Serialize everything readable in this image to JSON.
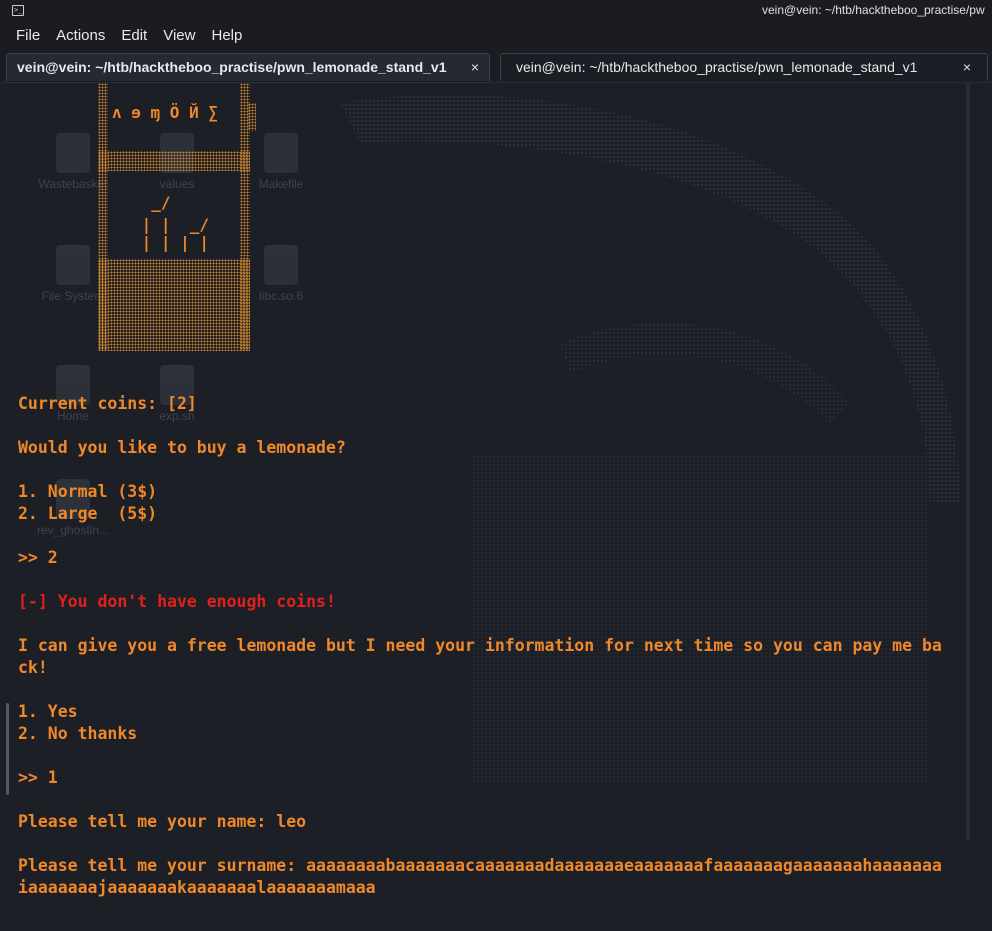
{
  "window": {
    "title": "vein@vein: ~/htb/hacktheboo_practise/pw",
    "menu": [
      "File",
      "Actions",
      "Edit",
      "View",
      "Help"
    ]
  },
  "tabs": [
    {
      "label": "vein@vein: ~/htb/hacktheboo_practise/pwn_lemonade_stand_v1",
      "close": "×",
      "active": true
    },
    {
      "label": "vein@vein: ~/htb/hacktheboo_practise/pwn_lemonade_stand_v1",
      "close": "×",
      "active": false
    }
  ],
  "desktop_icons": [
    {
      "label": "Wastebasket"
    },
    {
      "label": "values"
    },
    {
      "label": "Makefile"
    },
    {
      "label": "File System"
    },
    {
      "label": "libc.so.6"
    },
    {
      "label": "Home"
    },
    {
      "label": "exp.sh"
    },
    {
      "label": "rev_ghostin..."
    }
  ],
  "art": {
    "sign": "ʌ ɘ ɱ Ö Й ∑",
    "stick1": "  _/",
    "stick2": " | |  _/",
    "stick3": " | | | |"
  },
  "terminal": {
    "coins": "Current coins: [2]",
    "question": "Would you like to buy a lemonade?",
    "opt1": "1. Normal (3$)",
    "opt2": "2. Large  (5$)",
    "prompt1": ">> 2",
    "error": "[-] You don't have enough coins!",
    "offer_line1": "I can give you a free lemonade but I need your information for next time so you can pay me ba",
    "offer_line2": "ck!",
    "yes": "1. Yes",
    "no": "2. No thanks",
    "prompt2": ">> 1",
    "name_line": "Please tell me your name: leo",
    "surname_line1": "Please tell me your surname: aaaaaaaabaaaaaaacaaaaaaadaaaaaaaeaaaaaaafaaaaaaagaaaaaaahaaaaaaa",
    "surname_line2": "iaaaaaaajaaaaaaakaaaaaaalaaaaaaamaaa"
  },
  "colors": {
    "terminal_bg": "#1c1f26",
    "text_orange": "#f0882a",
    "text_red": "#e0201c"
  }
}
